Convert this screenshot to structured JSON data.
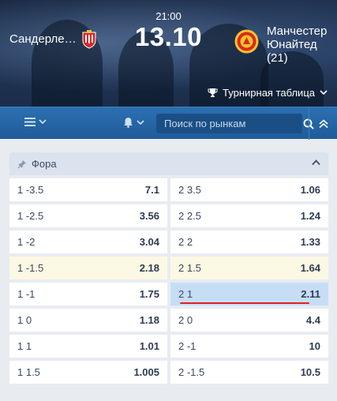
{
  "match": {
    "home_team": "Сандерле…",
    "away_team_line1": "Манчестер",
    "away_team_line2": "Юнайтед",
    "away_team_line3": "(21)",
    "time": "21:00",
    "date": "13.10",
    "standings_label": "Турнирная таблица"
  },
  "toolbar": {
    "search_placeholder": "Поиск по рынкам"
  },
  "market": {
    "title": "Фора",
    "left": [
      {
        "label": "1 -3.5",
        "odd": "7.1"
      },
      {
        "label": "1 -2.5",
        "odd": "3.56"
      },
      {
        "label": "1 -2",
        "odd": "3.04"
      },
      {
        "label": "1 -1.5",
        "odd": "2.18"
      },
      {
        "label": "1 -1",
        "odd": "1.75"
      },
      {
        "label": "1 0",
        "odd": "1.18"
      },
      {
        "label": "1 1",
        "odd": "1.01"
      },
      {
        "label": "1 1.5",
        "odd": "1.005"
      }
    ],
    "right": [
      {
        "label": "2 3.5",
        "odd": "1.06"
      },
      {
        "label": "2 2.5",
        "odd": "1.24"
      },
      {
        "label": "2 2",
        "odd": "1.33"
      },
      {
        "label": "2 1.5",
        "odd": "1.64"
      },
      {
        "label": "2 1",
        "odd": "2.11"
      },
      {
        "label": "2 0",
        "odd": "4.4"
      },
      {
        "label": "2 -1",
        "odd": "10"
      },
      {
        "label": "2 -1.5",
        "odd": "10.5"
      }
    ]
  },
  "colors": {
    "toolbar": "#1f5c99",
    "highlight_yellow": "#fbf8e3",
    "highlight_blue": "#c5def6",
    "underline_red": "#e02020"
  }
}
